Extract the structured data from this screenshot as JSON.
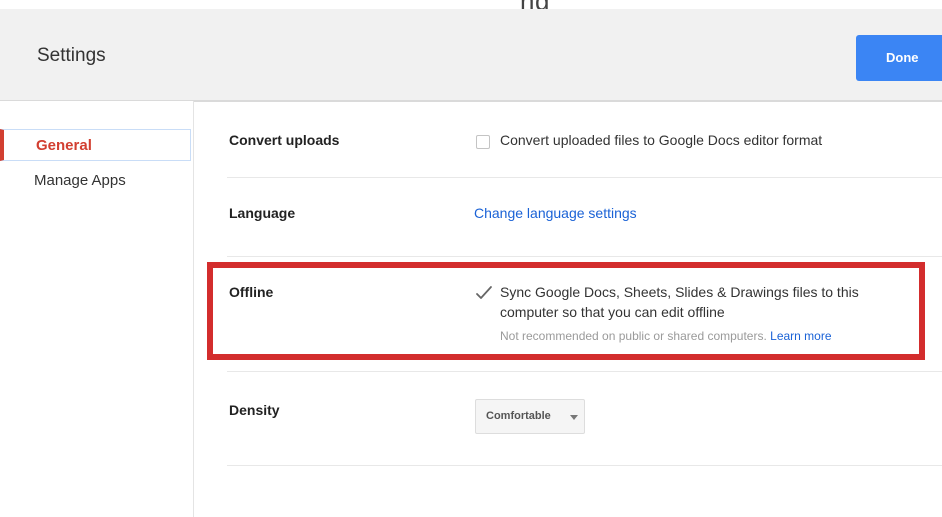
{
  "header": {
    "cropped_text": "ng",
    "title": "Settings",
    "done_label": "Done"
  },
  "sidebar": {
    "items": [
      {
        "label": "General",
        "active": true
      },
      {
        "label": "Manage Apps",
        "active": false
      }
    ]
  },
  "settings": {
    "convert_uploads": {
      "label": "Convert uploads",
      "option_text": "Convert uploaded files to Google Docs editor format",
      "checked": false
    },
    "language": {
      "label": "Language",
      "link_text": "Change language settings"
    },
    "offline": {
      "label": "Offline",
      "option_line1": "Sync Google Docs, Sheets, Slides & Drawings files to this",
      "option_line2": "computer so that you can edit offline",
      "note": "Not recommended on public or shared computers.",
      "learn_more": "Learn more",
      "checked": true
    },
    "density": {
      "label": "Density",
      "selected": "Comfortable"
    }
  },
  "colors": {
    "accent_blue": "#3b85f4",
    "link_blue": "#1a62d6",
    "active_red": "#d23f31",
    "highlight_red": "#d32d2d"
  }
}
